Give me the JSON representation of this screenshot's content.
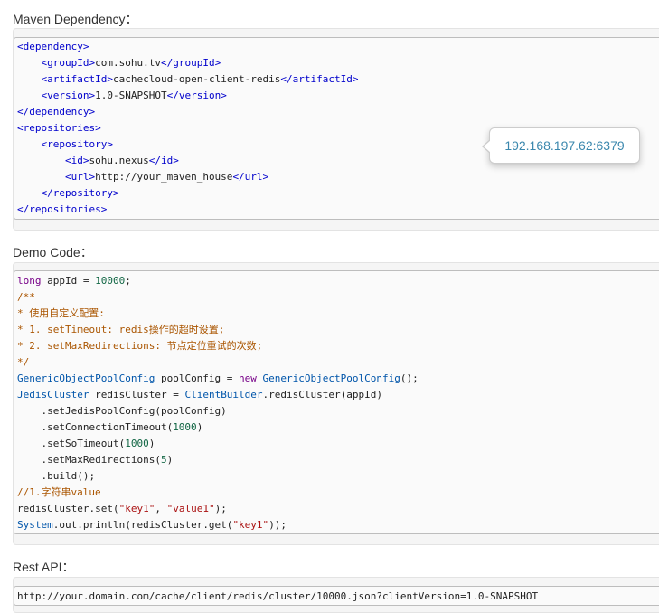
{
  "maven": {
    "title": "Maven Dependency：",
    "lines": [
      [
        [
          "tag",
          "<dependency>"
        ]
      ],
      [
        [
          "plain",
          "    "
        ],
        [
          "tag",
          "<groupId>"
        ],
        [
          "plain",
          "com.sohu.tv"
        ],
        [
          "tag",
          "</groupId>"
        ]
      ],
      [
        [
          "plain",
          "    "
        ],
        [
          "tag",
          "<artifactId>"
        ],
        [
          "plain",
          "cachecloud-open-client-redis"
        ],
        [
          "tag",
          "</artifactId>"
        ]
      ],
      [
        [
          "plain",
          "    "
        ],
        [
          "tag",
          "<version>"
        ],
        [
          "plain",
          "1.0-SNAPSHOT"
        ],
        [
          "tag",
          "</version>"
        ]
      ],
      [
        [
          "tag",
          "</dependency>"
        ]
      ],
      [
        [
          "tag",
          "<repositories>"
        ]
      ],
      [
        [
          "plain",
          "    "
        ],
        [
          "tag",
          "<repository>"
        ]
      ],
      [
        [
          "plain",
          "        "
        ],
        [
          "tag",
          "<id>"
        ],
        [
          "plain",
          "sohu.nexus"
        ],
        [
          "tag",
          "</id>"
        ]
      ],
      [
        [
          "plain",
          "        "
        ],
        [
          "tag",
          "<url>"
        ],
        [
          "plain",
          "http://your_maven_house"
        ],
        [
          "tag",
          "</url>"
        ]
      ],
      [
        [
          "plain",
          "    "
        ],
        [
          "tag",
          "</repository>"
        ]
      ],
      [
        [
          "tag",
          "</repositories>"
        ]
      ]
    ]
  },
  "tooltip": {
    "text": "192.168.197.62:6379"
  },
  "demo": {
    "title": "Demo Code：",
    "lines": [
      [
        [
          "kw",
          "long"
        ],
        [
          "plain",
          " appId = "
        ],
        [
          "num",
          "10000"
        ],
        [
          "plain",
          ";"
        ]
      ],
      [
        [
          "cmt",
          "/**"
        ]
      ],
      [
        [
          "cmt",
          "* 使用自定义配置:"
        ]
      ],
      [
        [
          "cmt",
          "* 1. setTimeout: redis操作的超时设置;"
        ]
      ],
      [
        [
          "cmt",
          "* 2. setMaxRedirections: 节点定位重试的次数;"
        ]
      ],
      [
        [
          "cmt",
          "*/"
        ]
      ],
      [
        [
          "typ",
          "GenericObjectPoolConfig"
        ],
        [
          "plain",
          " poolConfig = "
        ],
        [
          "kw",
          "new"
        ],
        [
          "plain",
          " "
        ],
        [
          "typ",
          "GenericObjectPoolConfig"
        ],
        [
          "plain",
          "();"
        ]
      ],
      [
        [
          "typ",
          "JedisCluster"
        ],
        [
          "plain",
          " redisCluster = "
        ],
        [
          "typ",
          "ClientBuilder"
        ],
        [
          "plain",
          ".redisCluster(appId)"
        ]
      ],
      [
        [
          "plain",
          "    .setJedisPoolConfig(poolConfig)"
        ]
      ],
      [
        [
          "plain",
          "    .setConnectionTimeout("
        ],
        [
          "num",
          "1000"
        ],
        [
          "plain",
          ")"
        ]
      ],
      [
        [
          "plain",
          "    .setSoTimeout("
        ],
        [
          "num",
          "1000"
        ],
        [
          "plain",
          ")"
        ]
      ],
      [
        [
          "plain",
          "    .setMaxRedirections("
        ],
        [
          "num",
          "5"
        ],
        [
          "plain",
          ")"
        ]
      ],
      [
        [
          "plain",
          "    .build();"
        ]
      ],
      [
        [
          "cmt",
          "//1.字符串value"
        ]
      ],
      [
        [
          "plain",
          "redisCluster.set("
        ],
        [
          "str",
          "\"key1\""
        ],
        [
          "plain",
          ", "
        ],
        [
          "str",
          "\"value1\""
        ],
        [
          "plain",
          ");"
        ]
      ],
      [
        [
          "typ",
          "System"
        ],
        [
          "plain",
          ".out.println(redisCluster.get("
        ],
        [
          "str",
          "\"key1\""
        ],
        [
          "plain",
          "));"
        ]
      ]
    ]
  },
  "rest": {
    "title": "Rest API：",
    "lines": [
      [
        [
          "plain",
          "http://your.domain.com/cache/client/redis/cluster/10000.json?clientVersion=1.0-SNAPSHOT"
        ]
      ]
    ]
  }
}
